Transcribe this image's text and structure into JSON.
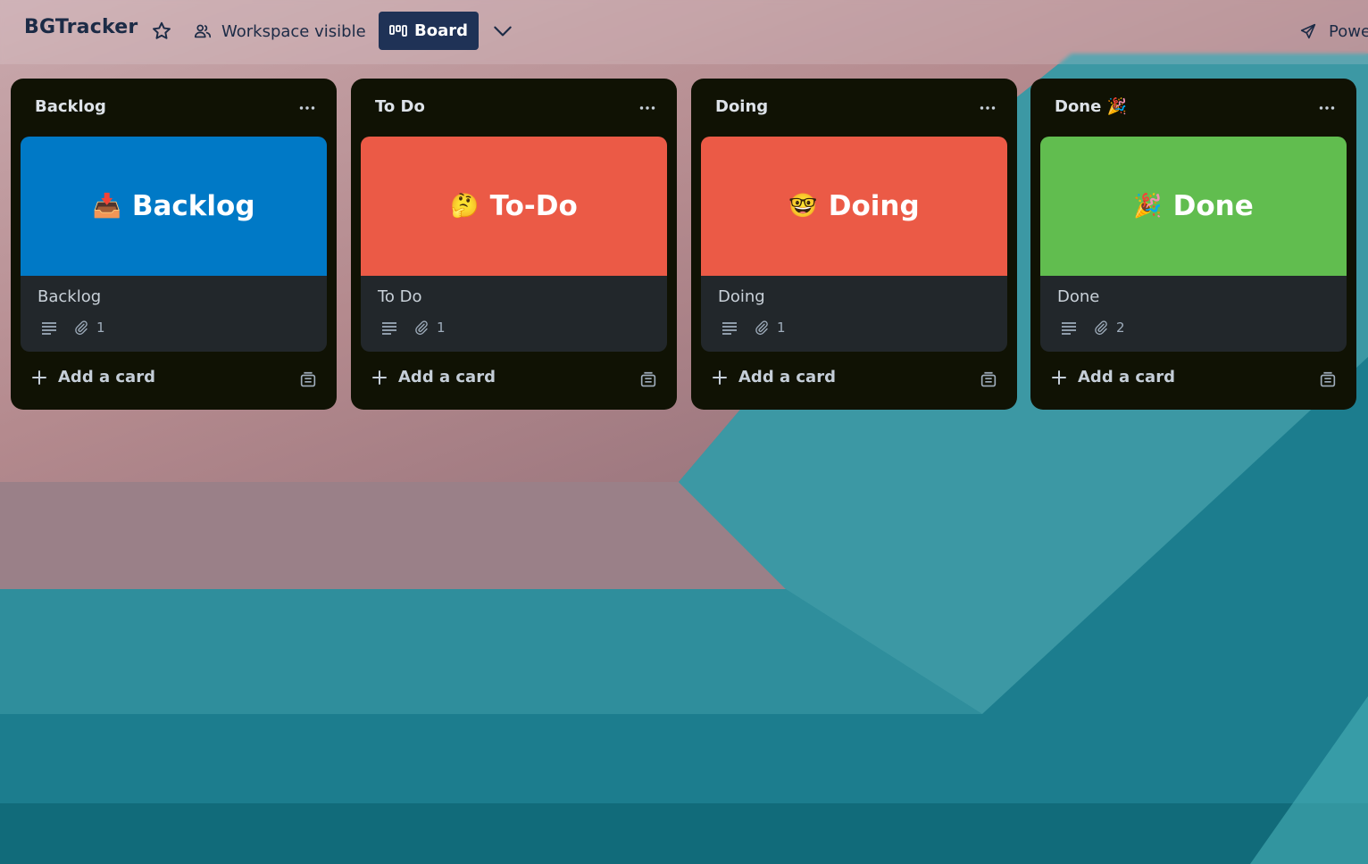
{
  "header": {
    "board_title": "BGTracker",
    "workspace_label": "Workspace visible",
    "view_label": "Board",
    "power_label": "Powe"
  },
  "lists": [
    {
      "title": "Backlog",
      "card": {
        "cover_emoji": "📥",
        "cover_text": "Backlog",
        "cover_color": "#0079c6",
        "title": "Backlog",
        "attachments": "1"
      },
      "add_label": "Add a card"
    },
    {
      "title": "To Do",
      "card": {
        "cover_emoji": "🤔",
        "cover_text": "To-Do",
        "cover_color": "#eb5a46",
        "title": "To Do",
        "attachments": "1"
      },
      "add_label": "Add a card"
    },
    {
      "title": "Doing",
      "card": {
        "cover_emoji": "🤓",
        "cover_text": "Doing",
        "cover_color": "#eb5a46",
        "title": "Doing",
        "attachments": "1"
      },
      "add_label": "Add a card"
    },
    {
      "title": "Done 🎉",
      "card": {
        "cover_emoji": "🎉",
        "cover_text": "Done",
        "cover_color": "#61bd4f",
        "title": "Done",
        "attachments": "2"
      },
      "add_label": "Add a card"
    }
  ]
}
